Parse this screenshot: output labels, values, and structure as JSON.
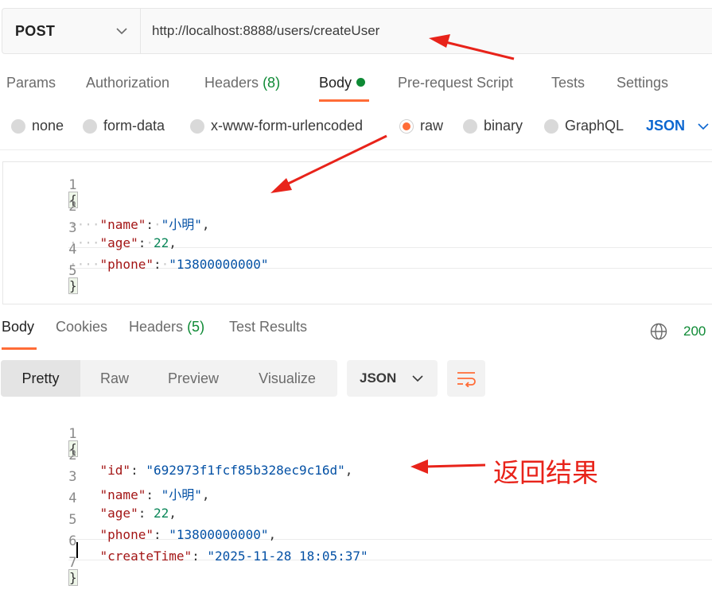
{
  "request": {
    "method": "POST",
    "url": "http://localhost:8888/users/createUser",
    "tabs": [
      {
        "label": "Params"
      },
      {
        "label": "Authorization"
      },
      {
        "label": "Headers",
        "count": "(8)"
      },
      {
        "label": "Body",
        "active": true,
        "indicator": "green-dot"
      },
      {
        "label": "Pre-request Script"
      },
      {
        "label": "Tests"
      },
      {
        "label": "Settings"
      }
    ],
    "body_types": [
      "none",
      "form-data",
      "x-www-form-urlencoded",
      "raw",
      "binary",
      "GraphQL"
    ],
    "selected_body_type": "raw",
    "language": "JSON",
    "body_lines": [
      {
        "n": "1",
        "text": "{"
      },
      {
        "n": "2",
        "key": "\"name\"",
        "value": "\"小明\"",
        "trail": ","
      },
      {
        "n": "3",
        "key": "\"age\"",
        "value": "22",
        "trail": ","
      },
      {
        "n": "4",
        "key": "\"phone\"",
        "value": "\"13800000000\"",
        "trail": ""
      },
      {
        "n": "5",
        "text": "}"
      }
    ]
  },
  "response": {
    "tabs": [
      {
        "label": "Body",
        "active": true
      },
      {
        "label": "Cookies"
      },
      {
        "label": "Headers",
        "count": "(5)"
      },
      {
        "label": "Test Results"
      }
    ],
    "status": "200",
    "view_modes": [
      "Pretty",
      "Raw",
      "Preview",
      "Visualize"
    ],
    "active_view": "Pretty",
    "format": "JSON",
    "body_lines": [
      {
        "n": "1",
        "text": "{"
      },
      {
        "n": "2",
        "key": "\"id\"",
        "value": "\"692973f1fcf85b328ec9c16d\"",
        "trail": ","
      },
      {
        "n": "3",
        "key": "\"name\"",
        "value": "\"小明\"",
        "trail": ","
      },
      {
        "n": "4",
        "key": "\"age\"",
        "value": "22",
        "trail": ","
      },
      {
        "n": "5",
        "key": "\"phone\"",
        "value": "\"13800000000\"",
        "trail": ","
      },
      {
        "n": "6",
        "key": "\"createTime\"",
        "value": "\"2025-11-28 18:05:37\"",
        "trail": ""
      },
      {
        "n": "7",
        "text": "}"
      }
    ]
  },
  "annotation": {
    "text": "返回结果"
  },
  "colors": {
    "accent": "#ff6c37",
    "success": "#0e8a35",
    "link": "#0b66d0",
    "annotation_red": "#e8231a",
    "json_key": "#a31515",
    "json_string": "#0451a5",
    "json_number": "#098658"
  },
  "icons": {
    "method_dropdown": "chevron-down-icon",
    "language_dropdown": "chevron-down-icon",
    "network": "globe-icon",
    "wrap": "wrap-lines-icon"
  }
}
